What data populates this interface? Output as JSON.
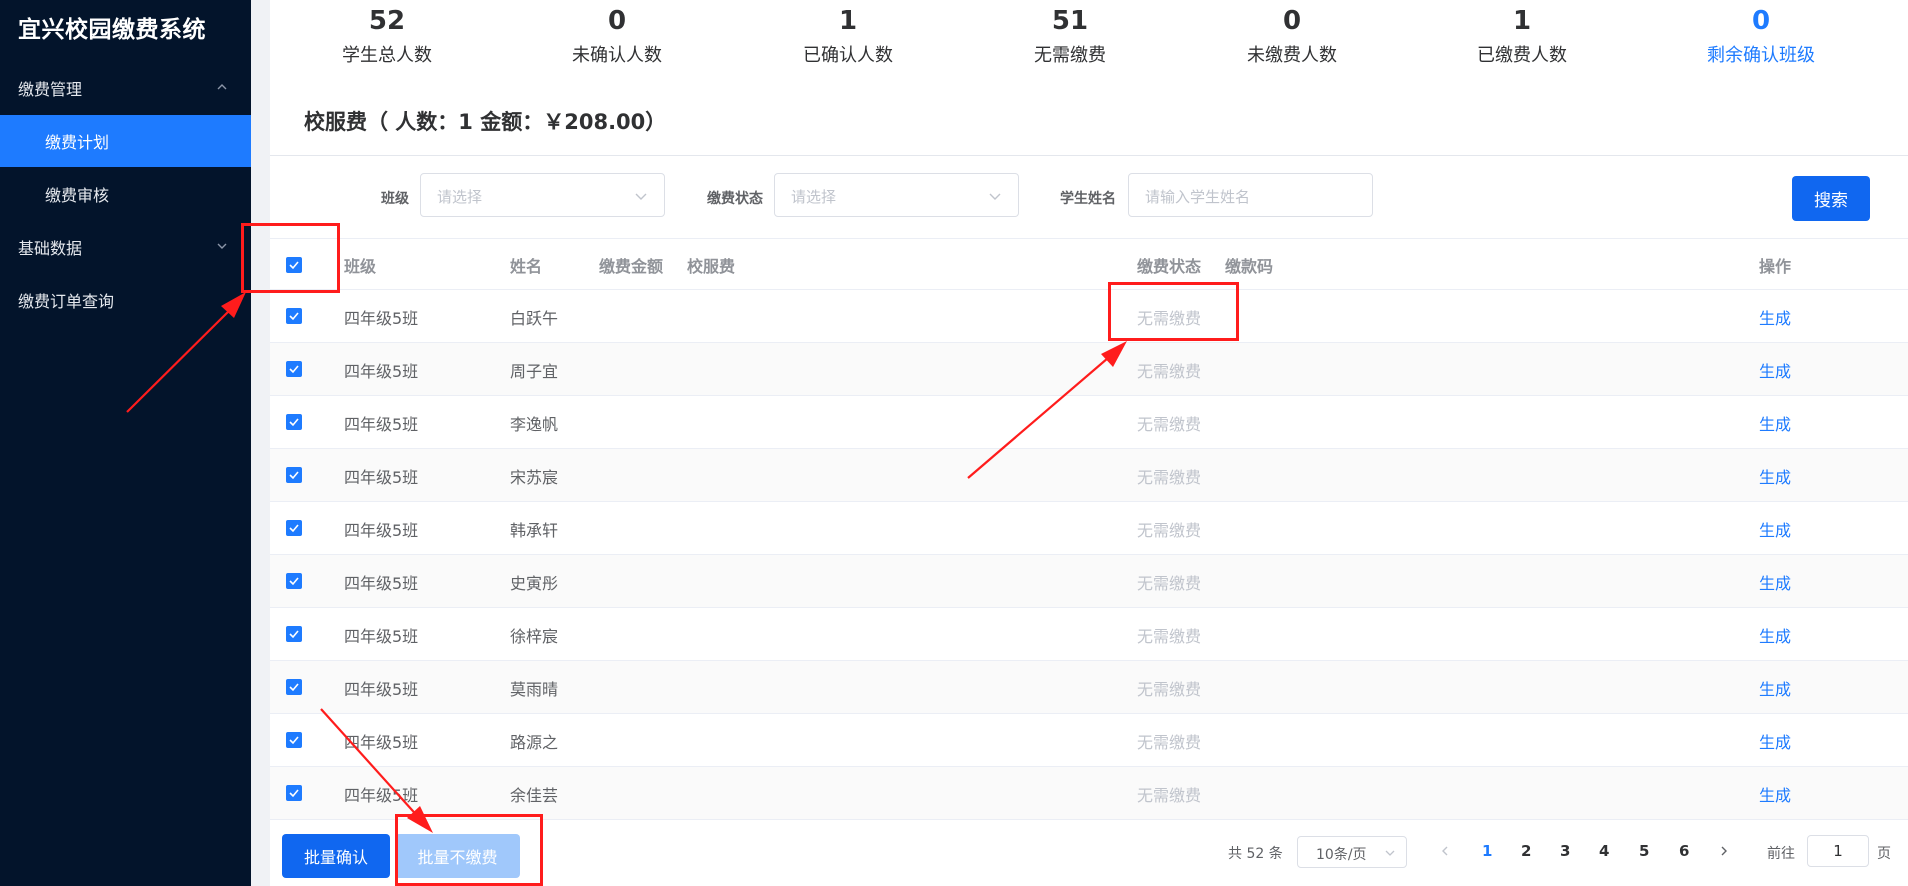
{
  "app": {
    "title": "宜兴校园缴费系统"
  },
  "sidebar": {
    "groups": [
      {
        "label": "缴费管理",
        "expanded": true
      },
      {
        "label": "基础数据",
        "expanded": false
      },
      {
        "label": "缴费订单查询"
      }
    ],
    "sub_items": [
      {
        "label": "缴费计划",
        "active": true
      },
      {
        "label": "缴费审核",
        "active": false
      }
    ]
  },
  "stats": [
    {
      "value": "52",
      "label": "学生总人数"
    },
    {
      "value": "0",
      "label": "未确认人数"
    },
    {
      "value": "1",
      "label": "已确认人数"
    },
    {
      "value": "51",
      "label": "无需缴费"
    },
    {
      "value": "0",
      "label": "未缴费人数"
    },
    {
      "value": "1",
      "label": "已缴费人数"
    },
    {
      "value": "0",
      "label": "剩余确认班级"
    }
  ],
  "fee_title": "校服费（ 人数：1 金额：￥208.00）",
  "filters": {
    "class_label": "班级",
    "class_placeholder": "请选择",
    "status_label": "缴费状态",
    "status_placeholder": "请选择",
    "name_label": "学生姓名",
    "name_placeholder": "请输入学生姓名",
    "search_button": "搜索"
  },
  "table": {
    "columns": [
      "班级",
      "姓名",
      "缴费金额",
      "校服费",
      "缴费状态",
      "缴款码",
      "操作"
    ],
    "rows": [
      {
        "class": "四年级5班",
        "name": "白跃午",
        "status": "无需缴费",
        "action": "生成"
      },
      {
        "class": "四年级5班",
        "name": "周子宜",
        "status": "无需缴费",
        "action": "生成"
      },
      {
        "class": "四年级5班",
        "name": "李逸帆",
        "status": "无需缴费",
        "action": "生成"
      },
      {
        "class": "四年级5班",
        "name": "宋苏宸",
        "status": "无需缴费",
        "action": "生成"
      },
      {
        "class": "四年级5班",
        "name": "韩承轩",
        "status": "无需缴费",
        "action": "生成"
      },
      {
        "class": "四年级5班",
        "name": "史寅彤",
        "status": "无需缴费",
        "action": "生成"
      },
      {
        "class": "四年级5班",
        "name": "徐梓宸",
        "status": "无需缴费",
        "action": "生成"
      },
      {
        "class": "四年级5班",
        "name": "莫雨晴",
        "status": "无需缴费",
        "action": "生成"
      },
      {
        "class": "四年级5班",
        "name": "路源之",
        "status": "无需缴费",
        "action": "生成"
      },
      {
        "class": "四年级5班",
        "name": "余佳芸",
        "status": "无需缴费",
        "action": "生成"
      }
    ]
  },
  "footer": {
    "batch_confirm": "批量确认",
    "batch_no_pay": "批量不缴费",
    "total": "共 52 条",
    "page_size": "10条/页",
    "pages": [
      "1",
      "2",
      "3",
      "4",
      "5",
      "6"
    ],
    "current_page": "1",
    "goto_label": "前往",
    "goto_value": "1",
    "goto_suffix": "页"
  },
  "colors": {
    "sidebar_bg": "#03142b",
    "accent": "#1e7bff",
    "annotation": "#ff1c1c"
  }
}
